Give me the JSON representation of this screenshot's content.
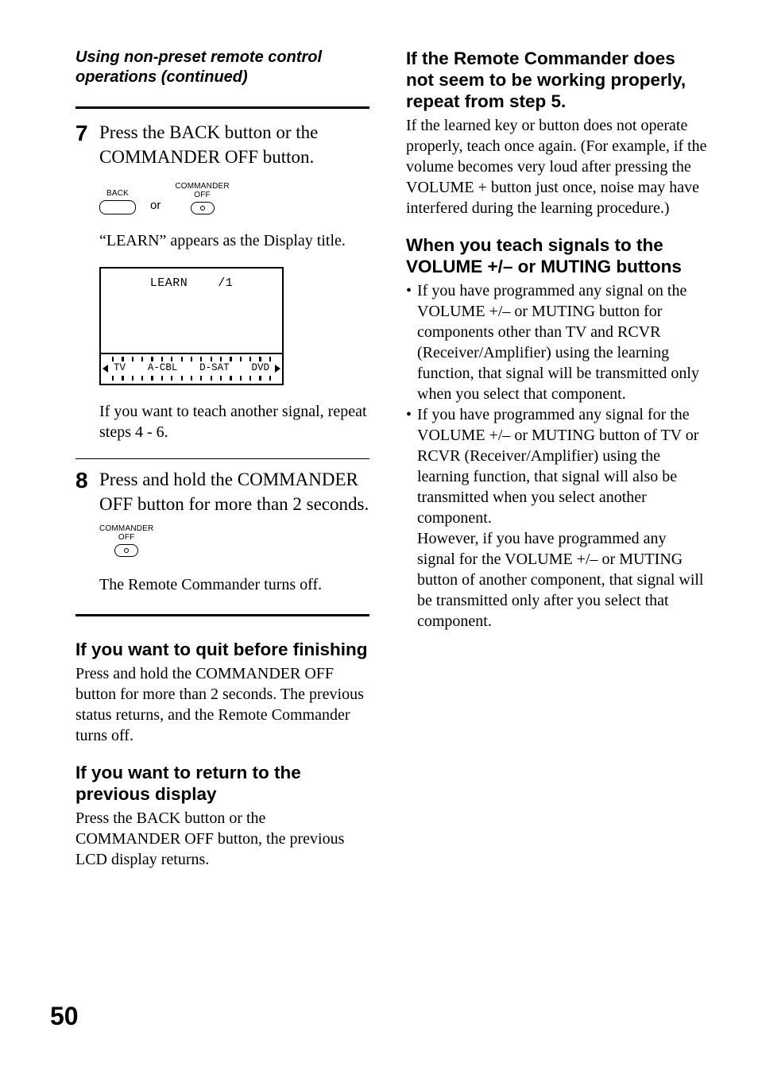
{
  "header_continued": "Using non-preset remote control operations (continued)",
  "steps": {
    "s7": {
      "num": "7",
      "text": "Press the BACK button or the COMMANDER OFF button.",
      "buttons": {
        "back_label": "BACK",
        "off_label_l1": "COMMANDER",
        "off_label_l2": "OFF",
        "or": "or"
      },
      "after": "“LEARN” appears as the Display title.",
      "lcd": {
        "title_left": "LEARN",
        "title_right": "/1",
        "labels": [
          "TV",
          "A-CBL",
          "D-SAT",
          "DVD"
        ]
      },
      "tail": "If you want to teach another signal, repeat steps 4 - 6."
    },
    "s8": {
      "num": "8",
      "text": "Press and hold the COMMANDER OFF button for more than 2 seconds.",
      "off_label_l1": "COMMANDER",
      "off_label_l2": "OFF",
      "tail": "The Remote Commander turns off."
    }
  },
  "left_sections": {
    "quit": {
      "title": "If you want to quit before finishing",
      "body": "Press and hold the COMMANDER OFF button for more than 2 seconds. The previous status returns, and the Remote Commander turns off."
    },
    "return": {
      "title": "If you want to return to the previous display",
      "body": "Press the BACK button or the COMMANDER OFF button, the previous LCD display returns."
    }
  },
  "right_sections": {
    "notworking": {
      "title": "If the Remote Commander does not seem to be working properly, repeat from step 5.",
      "body": "If the learned key or button does not operate properly, teach once again. (For example, if the volume becomes very loud after pressing the VOLUME + button just once, noise may have interfered during the learning procedure.)"
    },
    "teach": {
      "title": "When you teach signals to the VOLUME +/– or MUTING buttons",
      "b1": "If you have programmed any signal on the VOLUME +/– or MUTING button for components other than TV and RCVR (Receiver/Amplifier) using the learning function, that signal will be transmitted only when you select that component.",
      "b2a": "If you have programmed any signal for the VOLUME +/– or MUTING button of TV or RCVR (Receiver/Amplifier) using the learning function, that signal will also be transmitted when you select another component.",
      "b2b": "However, if you have programmed any signal for the VOLUME +/– or MUTING button of another component, that signal will be transmitted only after you select that component."
    }
  },
  "bullet_glyph": "•",
  "page_number": "50"
}
